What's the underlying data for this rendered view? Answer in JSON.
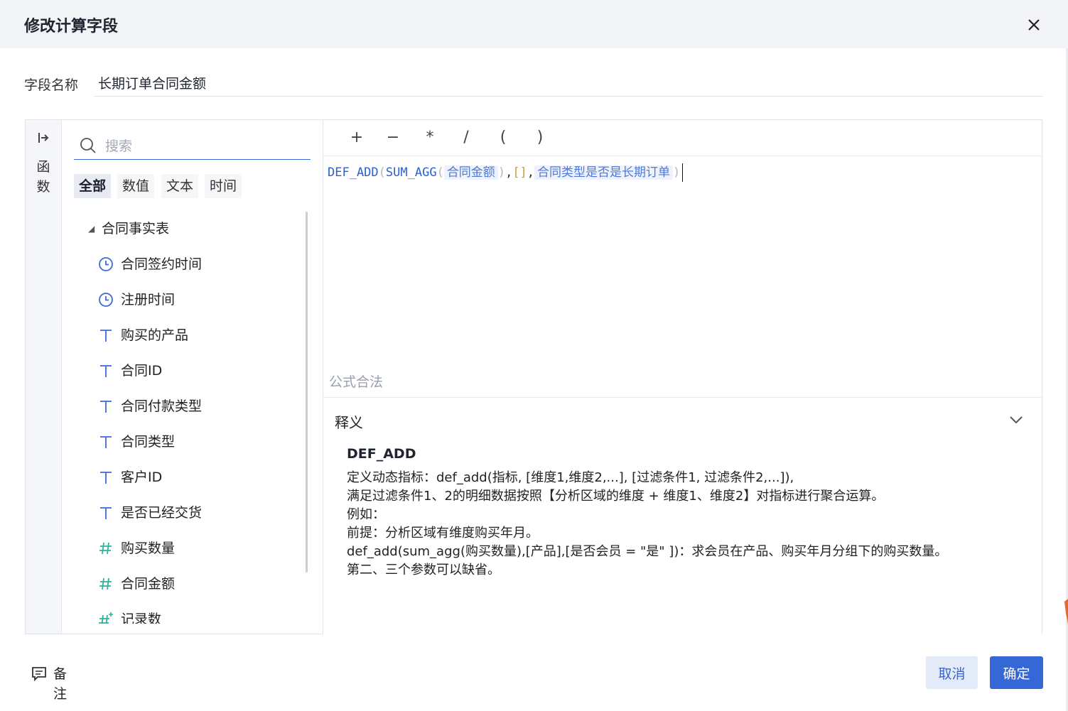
{
  "dialog": {
    "title": "修改计算字段",
    "close_icon": "close-icon"
  },
  "field_name": {
    "label": "字段名称",
    "value": "长期订单合同金额"
  },
  "function_rail": {
    "label_line1": "函",
    "label_line2": "数",
    "icon": "expand-arrow-icon"
  },
  "search": {
    "placeholder": "搜索",
    "icon": "search-icon"
  },
  "category_tabs": [
    {
      "label": "全部",
      "active": true
    },
    {
      "label": "数值",
      "active": false
    },
    {
      "label": "文本",
      "active": false
    },
    {
      "label": "时间",
      "active": false
    }
  ],
  "tree": {
    "root": "合同事实表",
    "items": [
      {
        "label": "合同签约时间",
        "type": "time",
        "icon": "clock-icon"
      },
      {
        "label": "注册时间",
        "type": "time",
        "icon": "clock-icon"
      },
      {
        "label": "购买的产品",
        "type": "text",
        "icon": "text-type-icon"
      },
      {
        "label": "合同ID",
        "type": "text",
        "icon": "text-type-icon"
      },
      {
        "label": "合同付款类型",
        "type": "text",
        "icon": "text-type-icon"
      },
      {
        "label": "合同类型",
        "type": "text",
        "icon": "text-type-icon"
      },
      {
        "label": "客户ID",
        "type": "text",
        "icon": "text-type-icon"
      },
      {
        "label": "是否已经交货",
        "type": "text",
        "icon": "text-type-icon"
      },
      {
        "label": "购买数量",
        "type": "number",
        "icon": "number-type-icon"
      },
      {
        "label": "合同金额",
        "type": "number",
        "icon": "number-type-icon"
      },
      {
        "label": "记录数",
        "type": "count",
        "icon": "record-count-icon"
      }
    ]
  },
  "operators": [
    "+",
    "−",
    "*",
    "/",
    "(",
    ")"
  ],
  "formula": {
    "fn_outer": "DEF_ADD",
    "open_paren": "(",
    "fn_inner": "SUM_AGG",
    "field1": "合同金额",
    "close_paren": ")",
    "comma": ",",
    "empty_list": "[]",
    "field2": "合同类型是否是长期订单"
  },
  "status": "公式合法",
  "explanation": {
    "title": "释义",
    "fn_name": "DEF_ADD",
    "lines": [
      "定义动态指标：def_add(指标, [维度1,维度2,...], [过滤条件1, 过滤条件2,...]),",
      "满足过滤条件1、2的明细数据按照【分析区域的维度 + 维度1、维度2】对指标进行聚合运算。",
      "例如：",
      "前提：分析区域有维度购买年月。",
      "def_add(sum_agg(购买数量),[产品],[是否会员 = \"是\" ])：求会员在产品、购买年月分组下的购买数量。",
      "第二、三个参数可以缺省。"
    ]
  },
  "footer": {
    "note_label": "备注",
    "note_icon": "note-icon",
    "cancel_label": "取消",
    "ok_label": "确定"
  },
  "colors": {
    "accent": "#3667d6",
    "field_token_bg": "#edf2fc",
    "header_bg": "#f2f4f7",
    "number_icon": "#2fb39a"
  }
}
